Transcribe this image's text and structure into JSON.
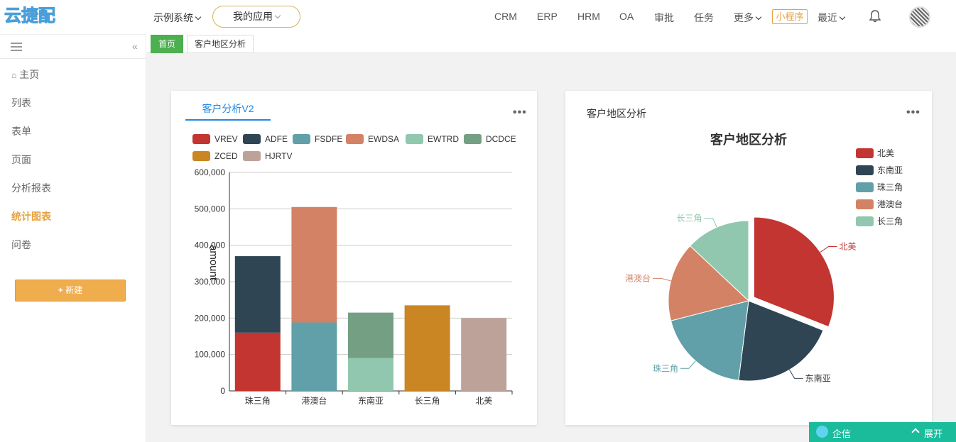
{
  "header": {
    "logo_text": "云捷配",
    "system_menu": "示例系统",
    "my_apps": "我的应用",
    "nav": [
      "CRM",
      "ERP",
      "HRM",
      "OA",
      "审批",
      "任务",
      "更多"
    ],
    "mini_program": "小程序",
    "recent": "最近"
  },
  "sidebar": {
    "items": [
      {
        "label": "主页",
        "icon": "home-icon"
      },
      {
        "label": "列表"
      },
      {
        "label": "表单"
      },
      {
        "label": "页面"
      },
      {
        "label": "分析报表"
      },
      {
        "label": "统计图表",
        "active": true
      },
      {
        "label": "问卷"
      }
    ],
    "new_button": "新建"
  },
  "tabs": [
    "首页",
    "客户地区分析"
  ],
  "cards": {
    "bar": {
      "tab_label": "客户分析V2"
    },
    "pie": {
      "title": "客户地区分析"
    }
  },
  "chat_widget": {
    "label": "企信",
    "expand": "展开"
  },
  "colors": {
    "accent": "#e6a23c",
    "home_tab": "#4caf50",
    "link_blue": "#1e88e5",
    "chat_bar": "#1abc9c"
  },
  "chart_data": [
    {
      "type": "bar",
      "stacked": true,
      "categories": [
        "珠三角",
        "港澳台",
        "东南亚",
        "长三角",
        "北美"
      ],
      "ylabel": "amount",
      "ylim": [
        0,
        600000
      ],
      "yticks": [
        "0",
        "100,000",
        "200,000",
        "300,000",
        "400,000",
        "500,000",
        "600,000"
      ],
      "legend": "top",
      "grid": true,
      "series": [
        {
          "name": "VREV",
          "color": "#c23531",
          "values": [
            160000,
            0,
            0,
            0,
            0
          ]
        },
        {
          "name": "ADFE",
          "color": "#2f4554",
          "values": [
            210000,
            0,
            0,
            0,
            0
          ]
        },
        {
          "name": "FSDFE",
          "color": "#61a0a8",
          "values": [
            0,
            188000,
            0,
            0,
            0
          ]
        },
        {
          "name": "EWDSA",
          "color": "#d48265",
          "values": [
            0,
            317000,
            0,
            0,
            0
          ]
        },
        {
          "name": "EWTRD",
          "color": "#91c7ae",
          "values": [
            0,
            0,
            90000,
            0,
            0
          ]
        },
        {
          "name": "DCDCE",
          "color": "#749f83",
          "values": [
            0,
            0,
            125000,
            0,
            0
          ]
        },
        {
          "name": "ZCED",
          "color": "#ca8622",
          "values": [
            0,
            0,
            0,
            235000,
            0
          ]
        },
        {
          "name": "HJRTV",
          "color": "#bda29a",
          "values": [
            0,
            0,
            0,
            0,
            200000
          ]
        }
      ]
    },
    {
      "type": "pie",
      "title": "客户地区分析",
      "legend": "top-right",
      "slices": [
        {
          "name": "北美",
          "value": 31,
          "color": "#c23531",
          "offset": true
        },
        {
          "name": "东南亚",
          "value": 21,
          "color": "#2f4554"
        },
        {
          "name": "珠三角",
          "value": 19,
          "color": "#61a0a8"
        },
        {
          "name": "港澳台",
          "value": 16,
          "color": "#d48265"
        },
        {
          "name": "长三角",
          "value": 13,
          "color": "#91c7ae"
        }
      ]
    }
  ]
}
